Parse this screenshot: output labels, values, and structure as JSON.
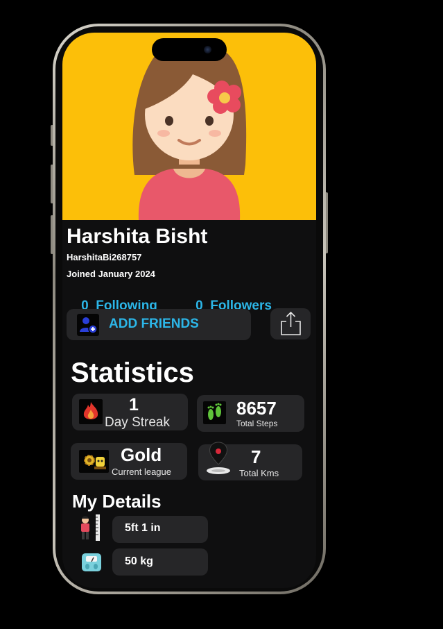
{
  "profile": {
    "name": "Harshita Bisht",
    "handle": "HarshitaBi268757",
    "joined": "Joined January 2024",
    "following_count": "0",
    "following_label": "Following",
    "followers_count": "0",
    "followers_label": "Followers"
  },
  "actions": {
    "add_friends": "ADD FRIENDS",
    "add_friends_icon": "add-user-icon",
    "share_icon": "share-icon"
  },
  "statistics": {
    "title": "Statistics",
    "streak": {
      "value": "1",
      "label": "Day Streak",
      "icon": "fire-icon"
    },
    "steps": {
      "value": "8657",
      "label": "Total Steps",
      "icon": "footsteps-icon"
    },
    "league": {
      "value": "Gold",
      "label": "Current league",
      "icon": "league-icon"
    },
    "distance": {
      "value": "7",
      "label": "Total Kms",
      "icon": "map-pin-icon"
    }
  },
  "details": {
    "title": "My Details",
    "height": {
      "value": "5ft 1 in",
      "icon": "height-icon"
    },
    "weight": {
      "value": "50 kg",
      "icon": "weighing-scale-icon"
    }
  },
  "colors": {
    "accent": "#2cb6e8",
    "hero_background": "#fcbf09",
    "card": "#262628",
    "screen": "#0f0f10"
  }
}
